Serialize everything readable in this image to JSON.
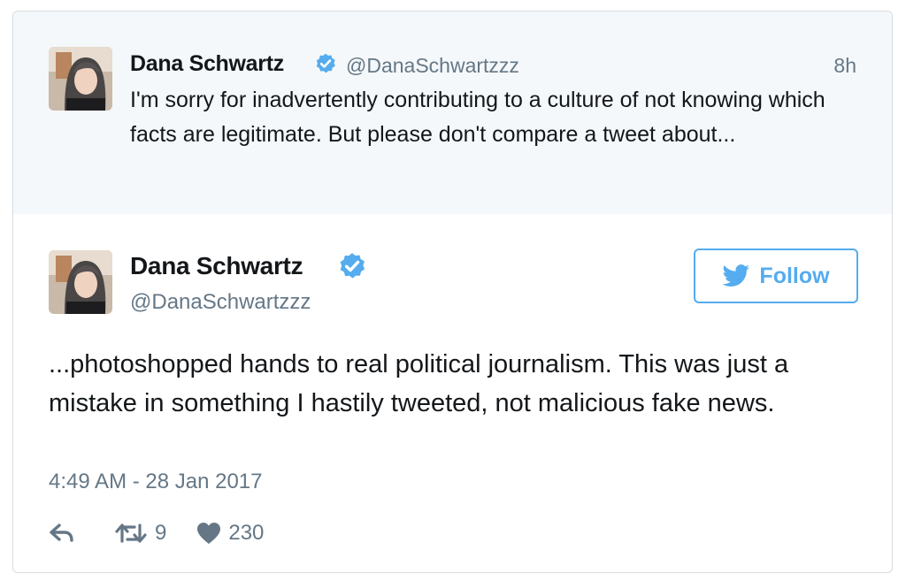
{
  "parent_tweet": {
    "author_name": "Dana Schwartz",
    "handle": "@DanaSchwartzzz",
    "time": "8h",
    "text": "I'm sorry for inadvertently contributing to a culture of not knowing which facts are legitimate. But please don't compare a tweet about...",
    "verified_icon": "verified-badge-icon",
    "avatar_icon": "avatar"
  },
  "main_tweet": {
    "author_name": "Dana Schwartz",
    "handle": "@DanaSchwartzzz",
    "follow_label": "Follow",
    "text": "...photoshopped hands to real political journalism. This was just a mistake in something I hastily tweeted, not malicious fake news.",
    "timestamp": "4:49 AM - 28 Jan 2017",
    "retweet_count": "9",
    "like_count": "230",
    "icons": [
      "reply-icon",
      "retweet-icon",
      "heart-icon",
      "twitter-bird-icon",
      "verified-badge-icon"
    ]
  },
  "colors": {
    "accent": "#55acee",
    "secondary_text": "#657786",
    "parent_background": "#f5f8fa",
    "border": "#d7dde2"
  }
}
